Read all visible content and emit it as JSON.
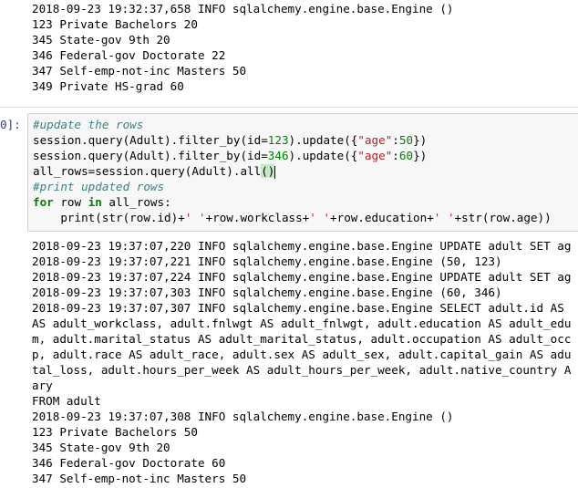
{
  "top_output": {
    "lines": [
      "2018-09-23 19:32:37,658 INFO sqlalchemy.engine.base.Engine ()",
      "123 Private Bachelors 20",
      "345 State-gov 9th 20",
      "346 Federal-gov Doctorate 22",
      "347 Self-emp-not-inc Masters 50",
      "349 Private HS-grad 60"
    ]
  },
  "cell": {
    "prompt": "0]:",
    "code": {
      "comment1": "#update the rows",
      "line2_pre": "session.query(Adult).filter_by(id=",
      "line2_num": "123",
      "line2_mid": ").update({",
      "line2_str": "\"age\"",
      "line2_colon": ":",
      "line2_val": "50",
      "line2_end": "})",
      "line3_pre": "session.query(Adult).filter_by(id=",
      "line3_num": "346",
      "line3_mid": ").update({",
      "line3_str": "\"age\"",
      "line3_colon": ":",
      "line3_val": "60",
      "line3_end": "})",
      "line4_pre": "all_rows=session.query(Adult).all",
      "line4_paren": "()",
      "comment2": "#print updated rows",
      "line6_kw_for": "for",
      "line6_mid": " row ",
      "line6_kw_in": "in",
      "line6_end": " all_rows:",
      "line7_pre": "    print(str(row.id)+",
      "line7_s1": "' '",
      "line7_a": "+row.workclass+",
      "line7_s2": "' '",
      "line7_b": "+row.education+",
      "line7_s3": "' '",
      "line7_c": "+str(row.age))"
    }
  },
  "bottom_output": {
    "lines": [
      "2018-09-23 19:37:07,220 INFO sqlalchemy.engine.base.Engine UPDATE adult SET ag",
      "2018-09-23 19:37:07,221 INFO sqlalchemy.engine.base.Engine (50, 123)",
      "2018-09-23 19:37:07,224 INFO sqlalchemy.engine.base.Engine UPDATE adult SET ag",
      "2018-09-23 19:37:07,303 INFO sqlalchemy.engine.base.Engine (60, 346)",
      "2018-09-23 19:37:07,307 INFO sqlalchemy.engine.base.Engine SELECT adult.id AS",
      "AS adult_workclass, adult.fnlwgt AS adult_fnlwgt, adult.education AS adult_edu",
      "m, adult.marital_status AS adult_marital_status, adult.occupation AS adult_occ",
      "p, adult.race AS adult_race, adult.sex AS adult_sex, adult.capital_gain AS adu",
      "tal_loss, adult.hours_per_week AS adult_hours_per_week, adult.native_country A",
      "ary",
      "FROM adult",
      "2018-09-23 19:37:07,308 INFO sqlalchemy.engine.base.Engine ()",
      "123 Private Bachelors 50",
      "345 State-gov 9th 20",
      "346 Federal-gov Doctorate 60",
      "347 Self-emp-not-inc Masters 50"
    ]
  }
}
